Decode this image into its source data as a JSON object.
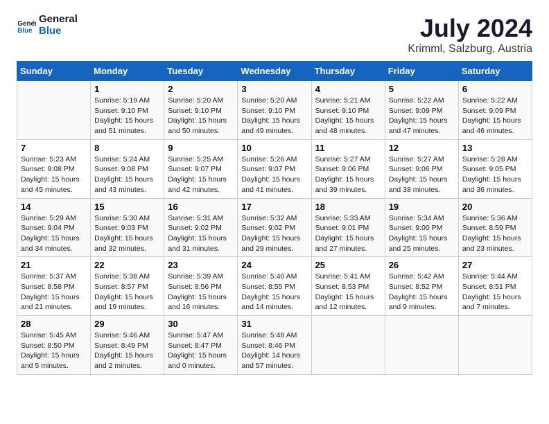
{
  "header": {
    "logo_line1": "General",
    "logo_line2": "Blue",
    "title": "July 2024",
    "subtitle": "Krimml, Salzburg, Austria"
  },
  "days_of_week": [
    "Sunday",
    "Monday",
    "Tuesday",
    "Wednesday",
    "Thursday",
    "Friday",
    "Saturday"
  ],
  "weeks": [
    [
      {
        "num": "",
        "text": ""
      },
      {
        "num": "1",
        "text": "Sunrise: 5:19 AM\nSunset: 9:10 PM\nDaylight: 15 hours\nand 51 minutes."
      },
      {
        "num": "2",
        "text": "Sunrise: 5:20 AM\nSunset: 9:10 PM\nDaylight: 15 hours\nand 50 minutes."
      },
      {
        "num": "3",
        "text": "Sunrise: 5:20 AM\nSunset: 9:10 PM\nDaylight: 15 hours\nand 49 minutes."
      },
      {
        "num": "4",
        "text": "Sunrise: 5:21 AM\nSunset: 9:10 PM\nDaylight: 15 hours\nand 48 minutes."
      },
      {
        "num": "5",
        "text": "Sunrise: 5:22 AM\nSunset: 9:09 PM\nDaylight: 15 hours\nand 47 minutes."
      },
      {
        "num": "6",
        "text": "Sunrise: 5:22 AM\nSunset: 9:09 PM\nDaylight: 15 hours\nand 46 minutes."
      }
    ],
    [
      {
        "num": "7",
        "text": "Sunrise: 5:23 AM\nSunset: 9:08 PM\nDaylight: 15 hours\nand 45 minutes."
      },
      {
        "num": "8",
        "text": "Sunrise: 5:24 AM\nSunset: 9:08 PM\nDaylight: 15 hours\nand 43 minutes."
      },
      {
        "num": "9",
        "text": "Sunrise: 5:25 AM\nSunset: 9:07 PM\nDaylight: 15 hours\nand 42 minutes."
      },
      {
        "num": "10",
        "text": "Sunrise: 5:26 AM\nSunset: 9:07 PM\nDaylight: 15 hours\nand 41 minutes."
      },
      {
        "num": "11",
        "text": "Sunrise: 5:27 AM\nSunset: 9:06 PM\nDaylight: 15 hours\nand 39 minutes."
      },
      {
        "num": "12",
        "text": "Sunrise: 5:27 AM\nSunset: 9:06 PM\nDaylight: 15 hours\nand 38 minutes."
      },
      {
        "num": "13",
        "text": "Sunrise: 5:28 AM\nSunset: 9:05 PM\nDaylight: 15 hours\nand 36 minutes."
      }
    ],
    [
      {
        "num": "14",
        "text": "Sunrise: 5:29 AM\nSunset: 9:04 PM\nDaylight: 15 hours\nand 34 minutes."
      },
      {
        "num": "15",
        "text": "Sunrise: 5:30 AM\nSunset: 9:03 PM\nDaylight: 15 hours\nand 32 minutes."
      },
      {
        "num": "16",
        "text": "Sunrise: 5:31 AM\nSunset: 9:02 PM\nDaylight: 15 hours\nand 31 minutes."
      },
      {
        "num": "17",
        "text": "Sunrise: 5:32 AM\nSunset: 9:02 PM\nDaylight: 15 hours\nand 29 minutes."
      },
      {
        "num": "18",
        "text": "Sunrise: 5:33 AM\nSunset: 9:01 PM\nDaylight: 15 hours\nand 27 minutes."
      },
      {
        "num": "19",
        "text": "Sunrise: 5:34 AM\nSunset: 9:00 PM\nDaylight: 15 hours\nand 25 minutes."
      },
      {
        "num": "20",
        "text": "Sunrise: 5:36 AM\nSunset: 8:59 PM\nDaylight: 15 hours\nand 23 minutes."
      }
    ],
    [
      {
        "num": "21",
        "text": "Sunrise: 5:37 AM\nSunset: 8:58 PM\nDaylight: 15 hours\nand 21 minutes."
      },
      {
        "num": "22",
        "text": "Sunrise: 5:38 AM\nSunset: 8:57 PM\nDaylight: 15 hours\nand 19 minutes."
      },
      {
        "num": "23",
        "text": "Sunrise: 5:39 AM\nSunset: 8:56 PM\nDaylight: 15 hours\nand 16 minutes."
      },
      {
        "num": "24",
        "text": "Sunrise: 5:40 AM\nSunset: 8:55 PM\nDaylight: 15 hours\nand 14 minutes."
      },
      {
        "num": "25",
        "text": "Sunrise: 5:41 AM\nSunset: 8:53 PM\nDaylight: 15 hours\nand 12 minutes."
      },
      {
        "num": "26",
        "text": "Sunrise: 5:42 AM\nSunset: 8:52 PM\nDaylight: 15 hours\nand 9 minutes."
      },
      {
        "num": "27",
        "text": "Sunrise: 5:44 AM\nSunset: 8:51 PM\nDaylight: 15 hours\nand 7 minutes."
      }
    ],
    [
      {
        "num": "28",
        "text": "Sunrise: 5:45 AM\nSunset: 8:50 PM\nDaylight: 15 hours\nand 5 minutes."
      },
      {
        "num": "29",
        "text": "Sunrise: 5:46 AM\nSunset: 8:49 PM\nDaylight: 15 hours\nand 2 minutes."
      },
      {
        "num": "30",
        "text": "Sunrise: 5:47 AM\nSunset: 8:47 PM\nDaylight: 15 hours\nand 0 minutes."
      },
      {
        "num": "31",
        "text": "Sunrise: 5:48 AM\nSunset: 8:46 PM\nDaylight: 14 hours\nand 57 minutes."
      },
      {
        "num": "",
        "text": ""
      },
      {
        "num": "",
        "text": ""
      },
      {
        "num": "",
        "text": ""
      }
    ]
  ]
}
